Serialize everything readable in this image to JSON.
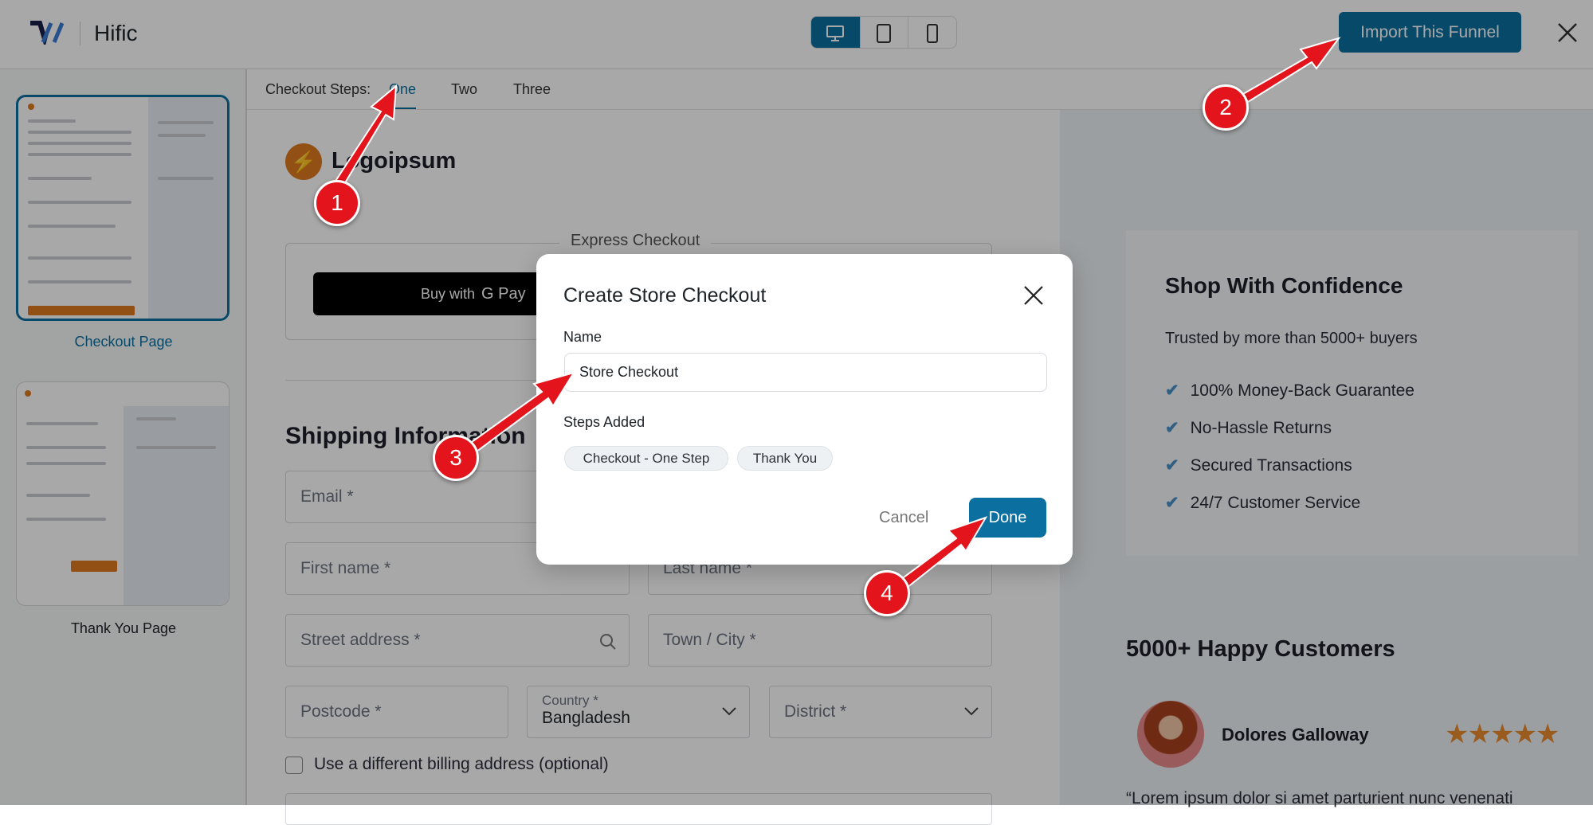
{
  "header": {
    "app_name": "Hific",
    "import_button": "Import This Funnel",
    "devices": [
      "desktop-icon",
      "tablet-icon",
      "mobile-icon"
    ],
    "accent": "#0b6fa0"
  },
  "steps_bar": {
    "label": "Checkout Steps:",
    "options": [
      "One",
      "Two",
      "Three"
    ],
    "active": "One"
  },
  "sidebar": {
    "pages": [
      {
        "label": "Checkout Page",
        "selected": true
      },
      {
        "label": "Thank You Page",
        "selected": false
      }
    ]
  },
  "checkout": {
    "logo_text": "Logoipsum",
    "express_label": "Express Checkout",
    "gpay_label": "Buy with",
    "gpay_brand": "G Pay",
    "shipping_title": "Shipping Information",
    "fields": {
      "email": "Email *",
      "first_name": "First name *",
      "last_name": "Last name *",
      "street": "Street address *",
      "town": "Town / City *",
      "postcode": "Postcode *",
      "country_label": "Country *",
      "country_value": "Bangladesh",
      "district": "District *"
    },
    "billing_checkbox": "Use a different billing address (optional)"
  },
  "right": {
    "confidence_title": "Shop With Confidence",
    "confidence_sub": "Trusted by more than 5000+ buyers",
    "items": [
      "100% Money-Back Guarantee",
      "No-Hassle Returns",
      "Secured Transactions",
      "24/7 Customer Service"
    ],
    "customers_title": "5000+ Happy Customers",
    "review": {
      "name": "Dolores Galloway",
      "stars": 5,
      "text": "“Lorem ipsum dolor si amet parturient nunc venenati"
    }
  },
  "dialog": {
    "title": "Create Store Checkout",
    "name_label": "Name",
    "name_value": "Store Checkout",
    "steps_label": "Steps Added",
    "steps": [
      "Checkout - One Step",
      "Thank You"
    ],
    "cancel": "Cancel",
    "done": "Done"
  },
  "annotations": [
    "1",
    "2",
    "3",
    "4"
  ]
}
